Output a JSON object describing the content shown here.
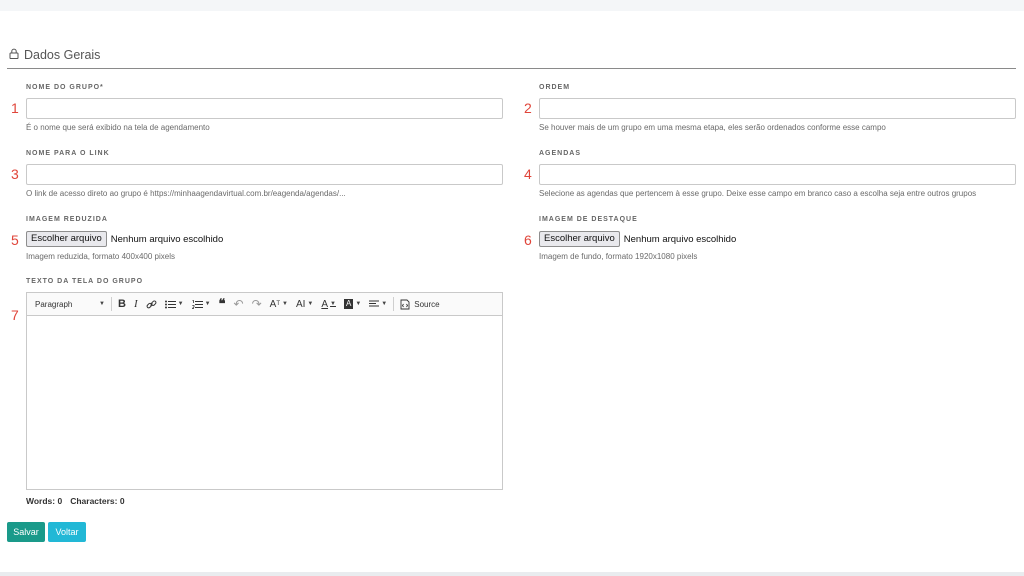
{
  "section": {
    "title": "Dados Gerais",
    "icon": "lock-icon"
  },
  "markers": [
    "1",
    "2",
    "3",
    "4",
    "5",
    "6",
    "7"
  ],
  "fields": {
    "nome_grupo": {
      "label": "NOME DO GRUPO*",
      "value": "",
      "hint": "É o nome que será exibido na tela de agendamento"
    },
    "ordem": {
      "label": "ORDEM",
      "value": "",
      "hint": "Se houver mais de um grupo em uma mesma etapa, eles serão ordenados conforme esse campo"
    },
    "nome_link": {
      "label": "NOME PARA O LINK",
      "value": "",
      "hint": "O link de acesso direto ao grupo é https://minhaagendavirtual.com.br/eagenda/agendas/..."
    },
    "agendas": {
      "label": "AGENDAS",
      "value": "",
      "hint": "Selecione as agendas que pertencem à esse grupo. Deixe esse campo em branco caso a escolha seja entre outros grupos"
    },
    "imagem_reduzida": {
      "label": "IMAGEM REDUZIDA",
      "button": "Escolher arquivo",
      "status": "Nenhum arquivo escolhido",
      "hint": "Imagem reduzida, formato 400x400 pixels"
    },
    "imagem_destaque": {
      "label": "IMAGEM DE DESTAQUE",
      "button": "Escolher arquivo",
      "status": "Nenhum arquivo escolhido",
      "hint": "Imagem de fundo, formato 1920x1080 pixels"
    },
    "texto": {
      "label": "TEXTO DA TELA DO GRUPO"
    }
  },
  "editor": {
    "paragraph": "Paragraph",
    "source": "Source",
    "words": "Words: 0",
    "characters": "Characters: 0"
  },
  "buttons": {
    "save": "Salvar",
    "back": "Voltar"
  },
  "colors": {
    "save": "#1a9a8a",
    "back": "#22b8d6",
    "marker": "#e0453a"
  }
}
